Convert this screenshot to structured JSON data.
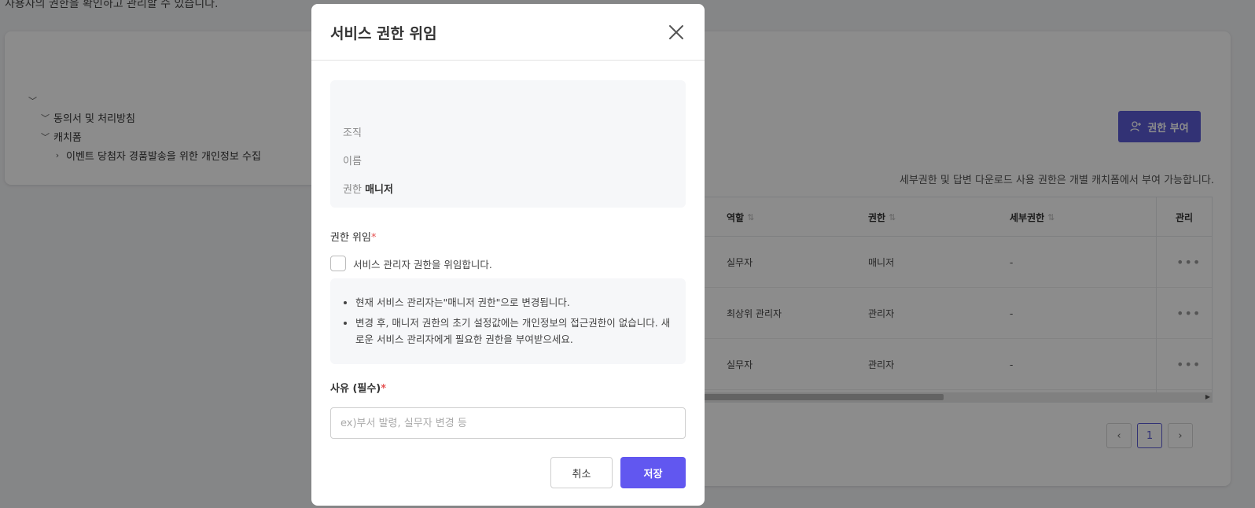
{
  "background": {
    "description": "사용자의 권한을 확인하고 관리할 수 있습니다.",
    "tree": [
      {
        "label": ""
      },
      {
        "label": "동의서 및 처리방침"
      },
      {
        "label": "캐치폼"
      },
      {
        "label": "이벤트 당첨자 경품발송을 위한 개인정보 수집"
      }
    ],
    "grant_button": "권한 부여",
    "hint": "세부권한 및 답변 다운로드 사용 권한은 개별 캐치폼에서 부여 가능합니다.",
    "table": {
      "headers": {
        "role": "역할",
        "permission": "권한",
        "detail": "세부권한",
        "manage": "관리"
      },
      "rows": [
        {
          "role": "실무자",
          "permission": "매니저",
          "detail": "-"
        },
        {
          "role": "최상위 관리자",
          "permission": "관리자",
          "detail": "-"
        },
        {
          "role": "실무자",
          "permission": "관리자",
          "detail": "-"
        }
      ]
    },
    "pagination": {
      "current": "1"
    }
  },
  "modal": {
    "title": "서비스 권한 위임",
    "info": {
      "org_label": "조직",
      "name_label": "이름",
      "permission_label": "권한",
      "permission_value": "매니저"
    },
    "delegate_label": "권한 위임",
    "checkbox_label": "서비스 관리자 권한을 위임합니다.",
    "notices": [
      "현재 서비스 관리자는\"매니저 권한\"으로 변경됩니다.",
      "변경 후, 매니저 권한의 초기 설정값에는 개인정보의 접근권한이 없습니다. 새로운 서비스 관리자에게 필요한 권한을 부여받으세요."
    ],
    "reason_label": "사유 (필수)",
    "reason_placeholder": "ex)부서 발령, 실무자 변경 등",
    "reason_value": "",
    "cancel_label": "취소",
    "save_label": "저장",
    "required_mark": "*"
  },
  "colors": {
    "accent": "#6157f0",
    "grant_button": "#5b5bd6",
    "required": "#e55353"
  }
}
